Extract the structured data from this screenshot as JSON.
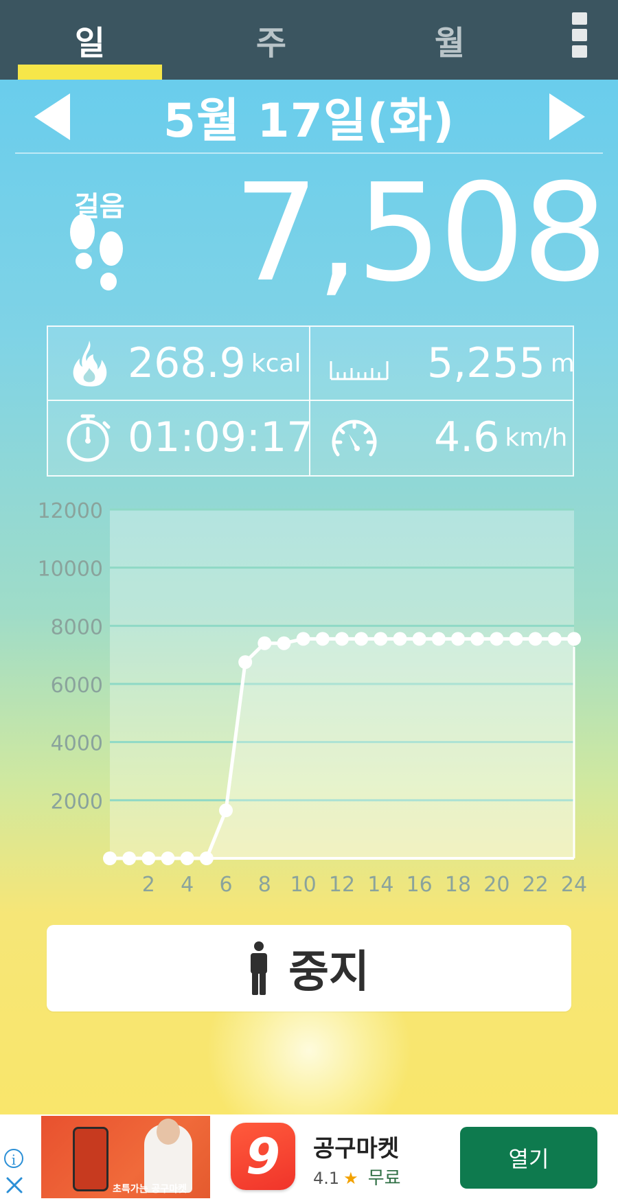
{
  "tabs": [
    {
      "label": "일",
      "active": true
    },
    {
      "label": "주",
      "active": false
    },
    {
      "label": "월",
      "active": false
    }
  ],
  "date": {
    "label": "5월 17일(화)"
  },
  "steps": {
    "label": "걸음",
    "value": "7,508"
  },
  "stats": {
    "calories": {
      "value": "268.9",
      "unit": "kcal",
      "icon": "flame-icon"
    },
    "distance": {
      "value": "5,255",
      "unit": "m",
      "icon": "ruler-icon"
    },
    "duration": {
      "value": "01:09:17",
      "icon": "stopwatch-icon"
    },
    "speed": {
      "value": "4.6",
      "unit": "km/h",
      "icon": "speedometer-icon"
    }
  },
  "chart_data": {
    "type": "line",
    "x": [
      0,
      1,
      2,
      3,
      4,
      5,
      6,
      7,
      8,
      9,
      10,
      11,
      12,
      13,
      14,
      15,
      16,
      17,
      18,
      19,
      20,
      21,
      22,
      23,
      24
    ],
    "values": [
      0,
      0,
      0,
      0,
      0,
      0,
      1650,
      6750,
      7400,
      7400,
      7550,
      7550,
      7550,
      7550,
      7550,
      7550,
      7550,
      7550,
      7550,
      7550,
      7550,
      7550,
      7550,
      7550,
      7550
    ],
    "x_ticks": [
      "2",
      "4",
      "6",
      "8",
      "10",
      "12",
      "14",
      "16",
      "18",
      "20",
      "22",
      "24"
    ],
    "y_ticks": [
      "12000",
      "10000",
      "8000",
      "6000",
      "4000",
      "2000"
    ],
    "ylim": [
      0,
      12000
    ],
    "xlim": [
      0,
      24
    ],
    "grid": true,
    "line_color": "#ffffff"
  },
  "stop_button": {
    "label": "중지",
    "icon": "person-icon"
  },
  "ad": {
    "banner_caption": "초특가는 공구마켓",
    "app_name": "공구마켓",
    "rating": "4.1",
    "price": "무료",
    "open_label": "열기",
    "info_glyph": "i"
  },
  "colors": {
    "tabbar": "#3b5560",
    "tab_indicator": "#f6e649",
    "ad_button": "#0e7a4e"
  }
}
